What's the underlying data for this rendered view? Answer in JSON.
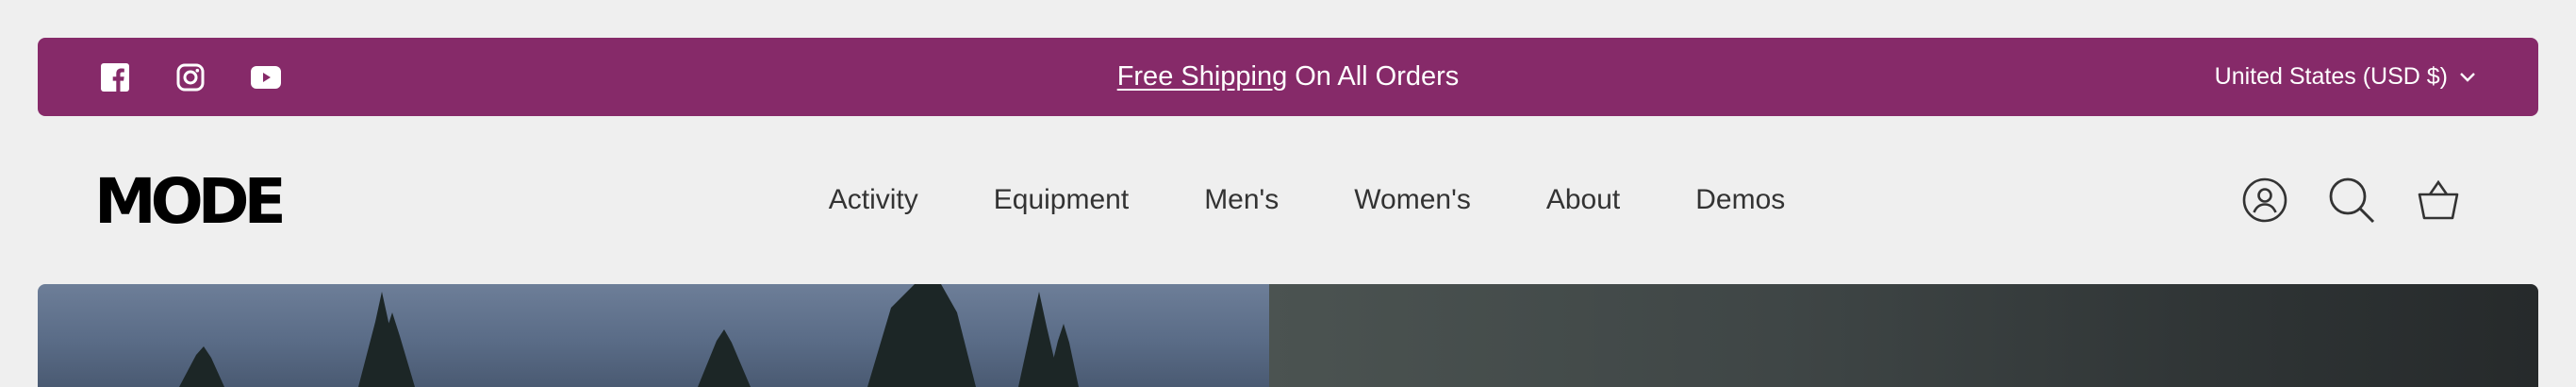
{
  "announcement": {
    "social": [
      {
        "icon": "facebook-icon"
      },
      {
        "icon": "instagram-icon"
      },
      {
        "icon": "youtube-icon"
      }
    ],
    "promo_link": "Free Shipping",
    "promo_rest": "On All Orders",
    "currency": "United States (USD $)",
    "background": "#862a69"
  },
  "header": {
    "logo": "MODE",
    "nav": [
      "Activity",
      "Equipment",
      "Men's",
      "Women's",
      "About",
      "Demos"
    ],
    "tools": [
      "account-icon",
      "search-icon",
      "cart-icon"
    ]
  },
  "hero": {
    "left_color": "#5f7089",
    "right_color": "#3b4142"
  }
}
